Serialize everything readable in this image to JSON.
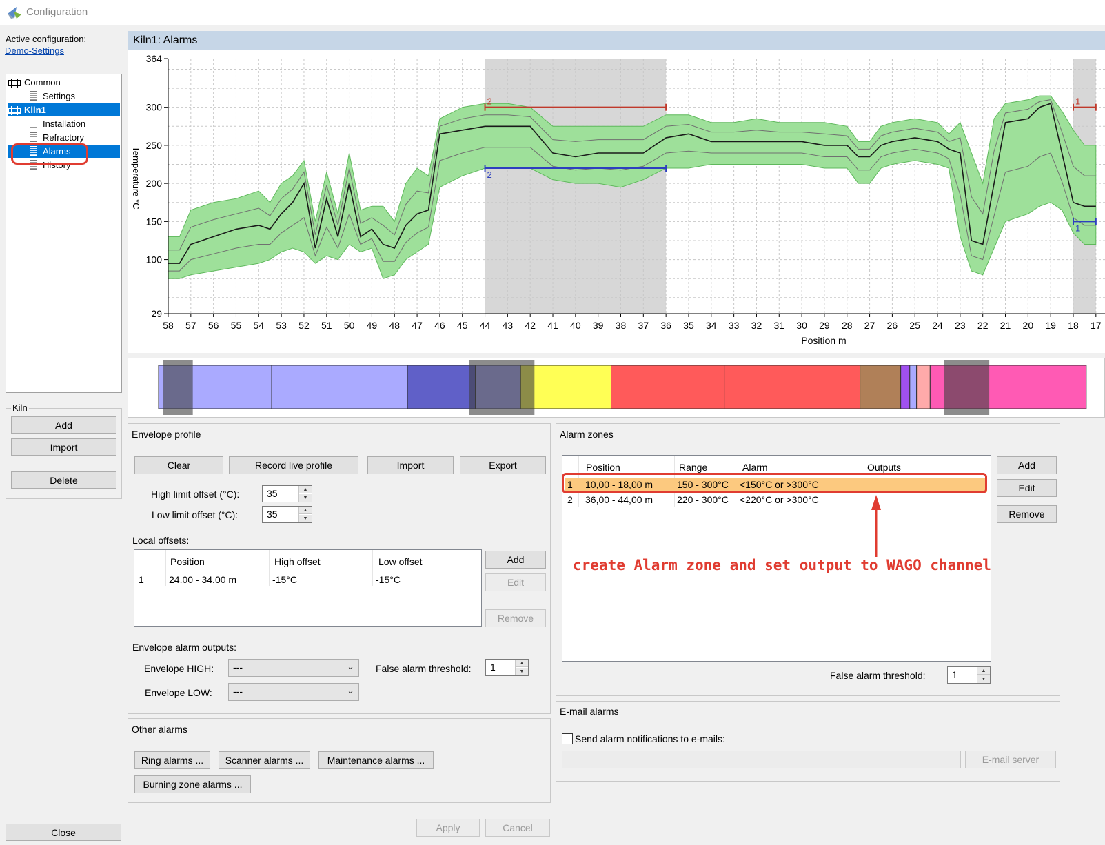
{
  "window": {
    "title": "Configuration"
  },
  "sidebar": {
    "active_config_label": "Active configuration:",
    "active_config_value": "Demo-Settings",
    "tree": [
      {
        "label": "Common",
        "icon": "kiln-icon",
        "level": 0
      },
      {
        "label": "Settings",
        "icon": "document-icon",
        "level": 1
      },
      {
        "label": "Kiln1",
        "icon": "kiln-icon",
        "level": 0,
        "selected": true
      },
      {
        "label": "Installation",
        "icon": "document-icon",
        "level": 1
      },
      {
        "label": "Refractory",
        "icon": "document-icon",
        "level": 1
      },
      {
        "label": "Alarms",
        "icon": "document-icon",
        "level": 1,
        "selected": true
      },
      {
        "label": "History",
        "icon": "document-icon",
        "level": 1
      }
    ],
    "kiln_group": {
      "title": "Kiln",
      "add": "Add",
      "import": "Import",
      "delete": "Delete"
    },
    "close": "Close"
  },
  "panel": {
    "title": "Kiln1: Alarms"
  },
  "chart_data": {
    "type": "area",
    "ylabel": "Temperature °C",
    "xlabel": "Position m",
    "ylim": [
      29,
      364
    ],
    "y_ticks": [
      364,
      300,
      250,
      200,
      150,
      100,
      29
    ],
    "xlim": [
      58,
      17
    ],
    "x_ticks": [
      58,
      57,
      56,
      55,
      54,
      53,
      52,
      51,
      50,
      49,
      48,
      47,
      46,
      45,
      44,
      43,
      42,
      41,
      40,
      39,
      38,
      37,
      36,
      35,
      34,
      33,
      32,
      31,
      30,
      29,
      28,
      27,
      26,
      25,
      24,
      23,
      22,
      21,
      20,
      19,
      18,
      17
    ],
    "grid": true,
    "shaded_zones": [
      {
        "from": 44,
        "to": 36,
        "label": "2",
        "high": 300,
        "low": 220
      },
      {
        "from": 18,
        "to": 17,
        "label": "1",
        "high": 300,
        "low": 150
      }
    ],
    "series": [
      {
        "name": "Envelope",
        "x": [
          58,
          57.5,
          57,
          56,
          55,
          54,
          53.5,
          53,
          52.5,
          52,
          51.5,
          51,
          50.5,
          50,
          49.5,
          49,
          48.5,
          48,
          47.5,
          47,
          46.5,
          46,
          45,
          44,
          43,
          42,
          41,
          40,
          39,
          38,
          37,
          36,
          35,
          34,
          33,
          32,
          31,
          30,
          29,
          28,
          27.5,
          27,
          26.5,
          26,
          25,
          24,
          23.5,
          23,
          22.5,
          22,
          21.5,
          21,
          20,
          19.5,
          19,
          18.5,
          18,
          17.5,
          17
        ],
        "high": [
          130,
          130,
          165,
          175,
          180,
          190,
          175,
          200,
          210,
          230,
          150,
          215,
          160,
          240,
          165,
          170,
          170,
          150,
          200,
          220,
          210,
          285,
          300,
          305,
          305,
          300,
          275,
          275,
          275,
          275,
          275,
          290,
          290,
          280,
          280,
          285,
          280,
          280,
          280,
          275,
          255,
          255,
          275,
          280,
          285,
          280,
          265,
          280,
          240,
          200,
          285,
          305,
          310,
          315,
          315,
          295,
          270,
          250,
          250
        ],
        "low": [
          75,
          75,
          80,
          85,
          90,
          95,
          100,
          110,
          115,
          110,
          95,
          105,
          100,
          120,
          110,
          115,
          75,
          80,
          100,
          110,
          120,
          195,
          210,
          220,
          220,
          220,
          205,
          200,
          200,
          195,
          205,
          220,
          220,
          225,
          225,
          225,
          225,
          225,
          220,
          220,
          200,
          200,
          220,
          225,
          230,
          225,
          220,
          130,
          85,
          80,
          115,
          150,
          160,
          170,
          175,
          165,
          135,
          120,
          120
        ],
        "center": [
          95,
          95,
          120,
          130,
          140,
          145,
          140,
          160,
          175,
          200,
          115,
          180,
          130,
          200,
          130,
          140,
          120,
          115,
          145,
          160,
          165,
          265,
          270,
          275,
          275,
          275,
          240,
          235,
          240,
          240,
          240,
          260,
          265,
          255,
          255,
          255,
          255,
          255,
          250,
          250,
          235,
          235,
          250,
          255,
          260,
          255,
          245,
          240,
          125,
          120,
          200,
          280,
          285,
          300,
          305,
          240,
          175,
          170,
          170
        ]
      }
    ]
  },
  "kiln_strip": [
    {
      "color": "#aaaaff",
      "from": 58,
      "to": 53
    },
    {
      "color": "#aaaaff",
      "from": 53,
      "to": 47
    },
    {
      "color": "#6060c8",
      "from": 47,
      "to": 44
    },
    {
      "color": "#aaaaff",
      "from": 44,
      "to": 42
    },
    {
      "color": "#ffff55",
      "from": 42,
      "to": 38
    },
    {
      "color": "#ff5a5a",
      "from": 38,
      "to": 33
    },
    {
      "color": "#ff5a5a",
      "from": 33,
      "to": 27
    },
    {
      "color": "#b08058",
      "from": 27,
      "to": 25.2
    },
    {
      "color": "#a050f0",
      "from": 25.2,
      "to": 24.8
    },
    {
      "color": "#aaaaff",
      "from": 24.8,
      "to": 24.5
    },
    {
      "color": "#ffaaaa",
      "from": 24.5,
      "to": 23.9
    },
    {
      "color": "#ff5ab4",
      "from": 23.9,
      "to": 17
    }
  ],
  "envelope_profile": {
    "title": "Envelope profile",
    "buttons": {
      "clear": "Clear",
      "record": "Record live profile",
      "import": "Import",
      "export": "Export"
    },
    "high_limit_label": "High limit offset (°C):",
    "high_limit_value": "35",
    "low_limit_label": "Low limit offset (°C):",
    "low_limit_value": "35",
    "local_offsets_label": "Local offsets:",
    "local_offsets": {
      "columns": [
        "",
        "Position",
        "High offset",
        "Low offset"
      ],
      "rows": [
        [
          "1",
          "24.00 - 34.00 m",
          "-15°C",
          "-15°C"
        ]
      ]
    },
    "local_buttons": {
      "add": "Add",
      "edit": "Edit",
      "remove": "Remove"
    },
    "outputs_label": "Envelope alarm outputs:",
    "env_high_label": "Envelope HIGH:",
    "env_high_value": "---",
    "env_low_label": "Envelope LOW:",
    "env_low_value": "---",
    "false_alarm_label": "False alarm threshold:",
    "false_alarm_value": "1"
  },
  "other_alarms": {
    "title": "Other alarms",
    "ring": "Ring alarms ...",
    "scanner": "Scanner alarms ...",
    "maintenance": "Maintenance alarms ...",
    "burning": "Burning zone alarms ..."
  },
  "alarm_zones": {
    "title": "Alarm zones",
    "columns": [
      "",
      "Position",
      "Range",
      "Alarm",
      "Outputs"
    ],
    "rows": [
      [
        "1",
        "10,00 - 18,00 m",
        "150 - 300°C",
        "<150°C or >300°C",
        ""
      ],
      [
        "2",
        "36,00 - 44,00 m",
        "220 - 300°C",
        "<220°C or >300°C",
        ""
      ]
    ],
    "buttons": {
      "add": "Add",
      "edit": "Edit",
      "remove": "Remove"
    },
    "false_alarm_label": "False alarm threshold:",
    "false_alarm_value": "1",
    "annotation": "create Alarm zone and set output to WAGO channel",
    "highlight_color": "#fcc97f",
    "annotation_color": "#e03c31"
  },
  "email_alarms": {
    "title": "E-mail alarms",
    "checkbox_label": "Send alarm notifications to e-mails:",
    "server_button": "E-mail server"
  },
  "footer": {
    "apply": "Apply",
    "cancel": "Cancel"
  }
}
